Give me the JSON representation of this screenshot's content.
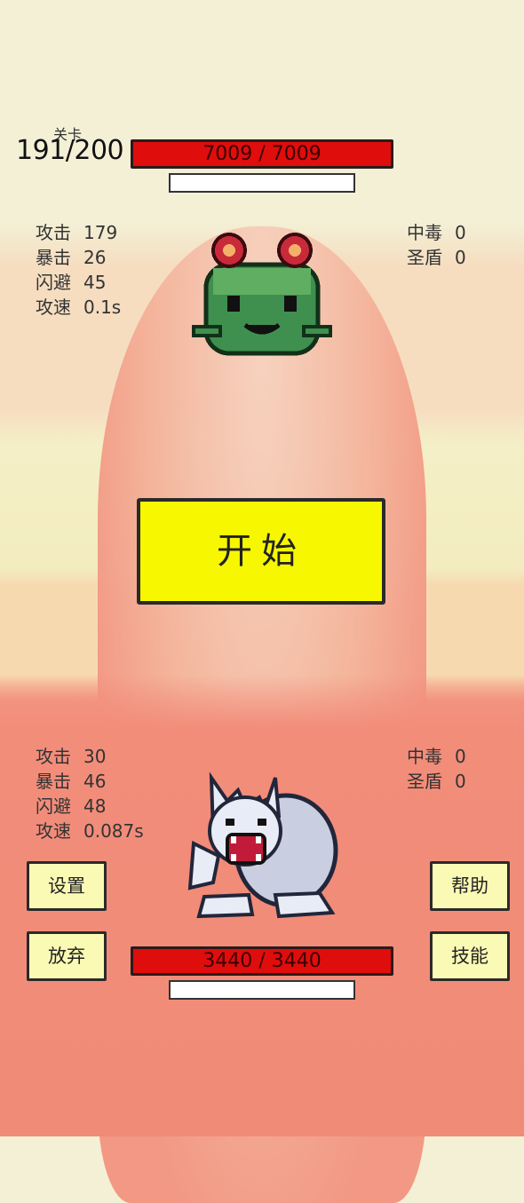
{
  "level": {
    "label": "关卡",
    "value": "191/200"
  },
  "enemy": {
    "hp_text": "7009 / 7009",
    "hp_fraction": 1.0,
    "stats_left": [
      {
        "key": "攻击",
        "value": "179"
      },
      {
        "key": "暴击",
        "value": "26"
      },
      {
        "key": "闪避",
        "value": "45"
      },
      {
        "key": "攻速",
        "value": "0.1s"
      }
    ],
    "stats_right": [
      {
        "key": "中毒",
        "value": "0"
      },
      {
        "key": "圣盾",
        "value": "0"
      }
    ],
    "sprite": "green-frog-monster-icon"
  },
  "player": {
    "hp_text": "3440 / 3440",
    "hp_fraction": 1.0,
    "stats_left": [
      {
        "key": "攻击",
        "value": "30"
      },
      {
        "key": "暴击",
        "value": "46"
      },
      {
        "key": "闪避",
        "value": "48"
      },
      {
        "key": "攻速",
        "value": "0.087s"
      }
    ],
    "stats_right": [
      {
        "key": "中毒",
        "value": "0"
      },
      {
        "key": "圣盾",
        "value": "0"
      }
    ],
    "sprite": "white-werewolf-icon"
  },
  "buttons": {
    "start": "开始",
    "settings": "设置",
    "help": "帮助",
    "give_up": "放弃",
    "skills": "技能"
  },
  "colors": {
    "hp_bar": "#e00d0d",
    "start_button": "#f7f700",
    "small_button": "#fafab4"
  }
}
